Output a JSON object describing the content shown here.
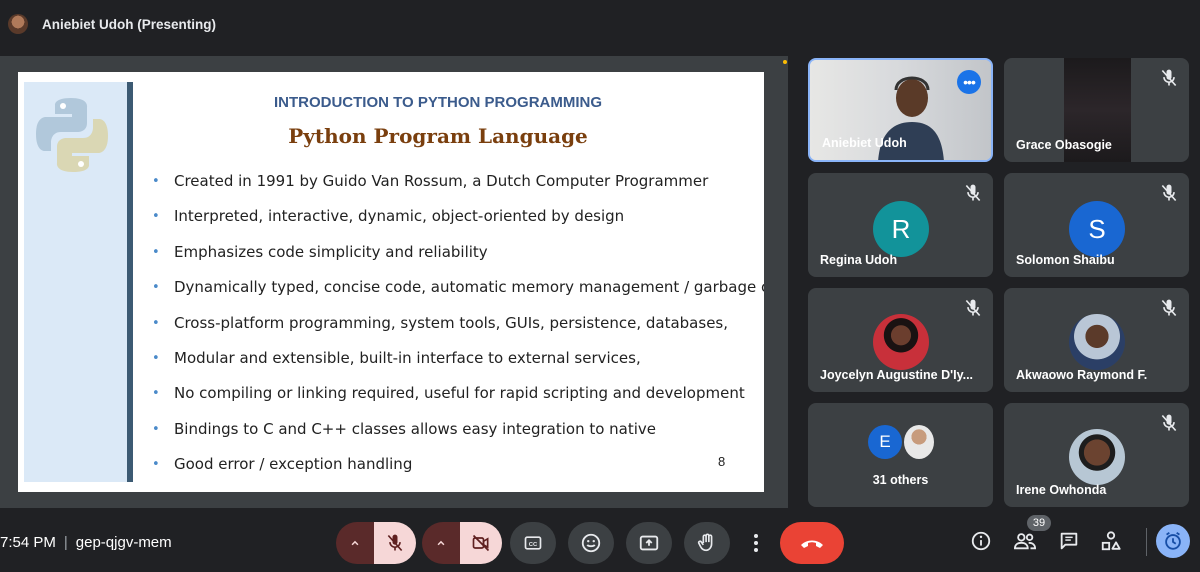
{
  "header": {
    "presenter_label": "Aniebiet Udoh (Presenting)"
  },
  "slide": {
    "heading": "INTRODUCTION TO PYTHON PROGRAMMING",
    "title": "Python Program Language",
    "bullets": [
      "Created in 1991 by Guido Van Rossum, a Dutch Computer Programmer",
      "Interpreted, interactive, dynamic, object-oriented by design",
      "Emphasizes code simplicity and reliability",
      "Dynamically typed, concise code, automatic memory management / garbage collection",
      "Cross-platform programming, system tools, GUIs, persistence, databases,",
      "Modular and extensible, built-in interface to external services,",
      "No compiling or linking required, useful for rapid scripting and development",
      "Bindings to C and C++ classes allows easy integration to native",
      " Good error / exception handling"
    ],
    "page_number": "8"
  },
  "participants": [
    {
      "name": "Aniebiet Udoh"
    },
    {
      "name": "Grace Obasogie"
    },
    {
      "name": "Regina Udoh",
      "initial": "R",
      "color": "#12939a"
    },
    {
      "name": "Solomon Shaibu",
      "initial": "S",
      "color": "#1967d2"
    },
    {
      "name": "Joycelyn Augustine D'Iy..."
    },
    {
      "name": "Akwaowo Raymond F."
    },
    {
      "name": "31 others",
      "initial": "E",
      "color": "#1967d2"
    },
    {
      "name": "Irene Owhonda"
    }
  ],
  "bottom": {
    "time": "7:54 PM",
    "meeting_code": "gep-qjgv-mem",
    "participant_count": "39"
  },
  "colors": {
    "end_call": "#ea4335",
    "accent": "#8ab4f8"
  },
  "icons": [
    "mic-off-icon",
    "camera-off-icon",
    "captions-icon",
    "emoji-icon",
    "present-icon",
    "raise-hand-icon",
    "more-options-icon",
    "end-call-icon",
    "info-icon",
    "people-icon",
    "chat-icon",
    "activities-icon",
    "clock-icon"
  ]
}
